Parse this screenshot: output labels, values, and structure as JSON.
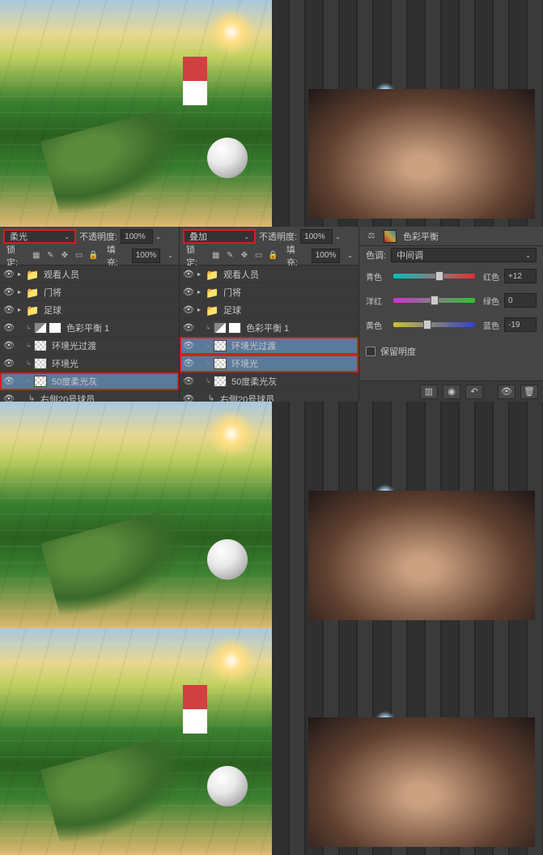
{
  "panels": {
    "left": {
      "blend_mode": "柔光",
      "opacity_label": "不透明度:",
      "opacity": "100%",
      "lock_label": "锁定:",
      "fill_label": "填充:",
      "fill": "100%",
      "layers": [
        {
          "kind": "group",
          "name": "观看人员"
        },
        {
          "kind": "group",
          "name": "门将"
        },
        {
          "kind": "group",
          "name": "足球"
        },
        {
          "kind": "adj",
          "name": "色彩平衡 1",
          "linked": true
        },
        {
          "kind": "trans",
          "name": "环境光过渡",
          "linked": true
        },
        {
          "kind": "trans",
          "name": "环境光",
          "linked": true
        },
        {
          "kind": "trans",
          "name": "50度柔光灰",
          "sel": true,
          "hl": true,
          "linked": true
        },
        {
          "kind": "clip",
          "name": "右侧20号球员"
        }
      ]
    },
    "right": {
      "blend_mode": "叠加",
      "opacity_label": "不透明度:",
      "opacity": "100%",
      "lock_label": "锁定:",
      "fill_label": "填充:",
      "fill": "100%",
      "layers": [
        {
          "kind": "group",
          "name": "观看人员"
        },
        {
          "kind": "group",
          "name": "门将"
        },
        {
          "kind": "group",
          "name": "足球"
        },
        {
          "kind": "adj",
          "name": "色彩平衡 1",
          "linked": true
        },
        {
          "kind": "trans",
          "name": "环境光过渡",
          "sel": true,
          "hl": true,
          "linked": true
        },
        {
          "kind": "trans",
          "name": "环境光",
          "sel": true,
          "hl": true,
          "linked": true
        },
        {
          "kind": "trans",
          "name": "50度柔光灰",
          "linked": true
        },
        {
          "kind": "clip",
          "name": "右侧20号球员"
        }
      ]
    }
  },
  "color_balance": {
    "title": "色彩平衡",
    "tone_label": "色调:",
    "tone_value": "中间调",
    "sliders": [
      {
        "left": "青色",
        "right": "红色",
        "value": "+12",
        "pos": 56
      },
      {
        "left": "洋红",
        "right": "绿色",
        "value": "0",
        "pos": 50
      },
      {
        "left": "黄色",
        "right": "蓝色",
        "value": "-19",
        "pos": 42
      }
    ],
    "preserve_label": "保留明度"
  },
  "chart_data": {
    "type": "table",
    "title": "Color Balance (中间调)",
    "rows": [
      {
        "axis": "青色–红色",
        "value": 12
      },
      {
        "axis": "洋红–绿色",
        "value": 0
      },
      {
        "axis": "黄色–蓝色",
        "value": -19
      }
    ]
  }
}
